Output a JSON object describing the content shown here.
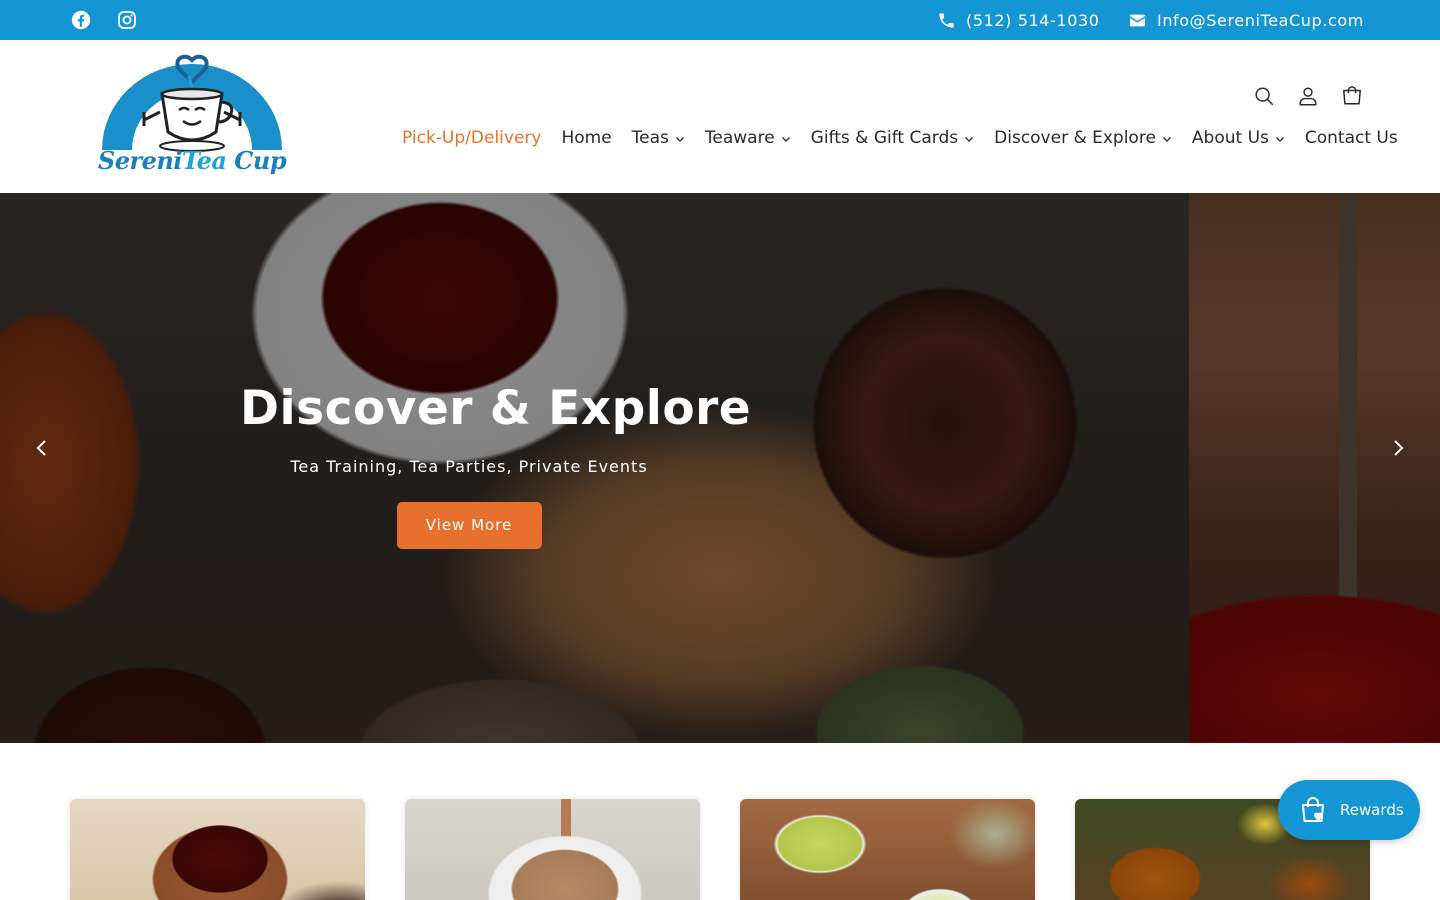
{
  "topbar": {
    "social": [
      {
        "name": "facebook",
        "icon": "facebook-icon"
      },
      {
        "name": "instagram",
        "icon": "instagram-icon"
      }
    ],
    "phone": "(512) 514-1030",
    "email": "Info@SereniTeaCup.com",
    "background": "#1396d3"
  },
  "header": {
    "logo": {
      "word1": "Sereni",
      "word2": "Tea",
      "word3": " Cup"
    },
    "icons": [
      "search-icon",
      "account-icon",
      "cart-icon"
    ],
    "nav": [
      {
        "label": "Pick-Up/Delivery",
        "active": true,
        "dropdown": false
      },
      {
        "label": "Home",
        "active": false,
        "dropdown": false
      },
      {
        "label": "Teas",
        "active": false,
        "dropdown": true
      },
      {
        "label": "Teaware",
        "active": false,
        "dropdown": true
      },
      {
        "label": "Gifts & Gift Cards",
        "active": false,
        "dropdown": true
      },
      {
        "label": "Discover & Explore",
        "active": false,
        "dropdown": true
      },
      {
        "label": "About Us",
        "active": false,
        "dropdown": true
      },
      {
        "label": "Contact Us",
        "active": false,
        "dropdown": false
      }
    ],
    "active_color": "#e8702e"
  },
  "hero": {
    "title": "Discover & Explore",
    "subtitle": "Tea Training, Tea Parties, Private Events",
    "button_label": "View More",
    "button_color": "#e8702e",
    "prev_icon": "chevron-left-icon",
    "next_icon": "chevron-right-icon"
  },
  "cards": [
    {
      "name": "black-tea-card"
    },
    {
      "name": "chai-tea-card"
    },
    {
      "name": "green-tea-card"
    },
    {
      "name": "herbal-tea-card"
    }
  ],
  "rewards": {
    "label": "Rewards",
    "icon": "shopping-bag-heart-icon",
    "color": "#1396d3"
  }
}
